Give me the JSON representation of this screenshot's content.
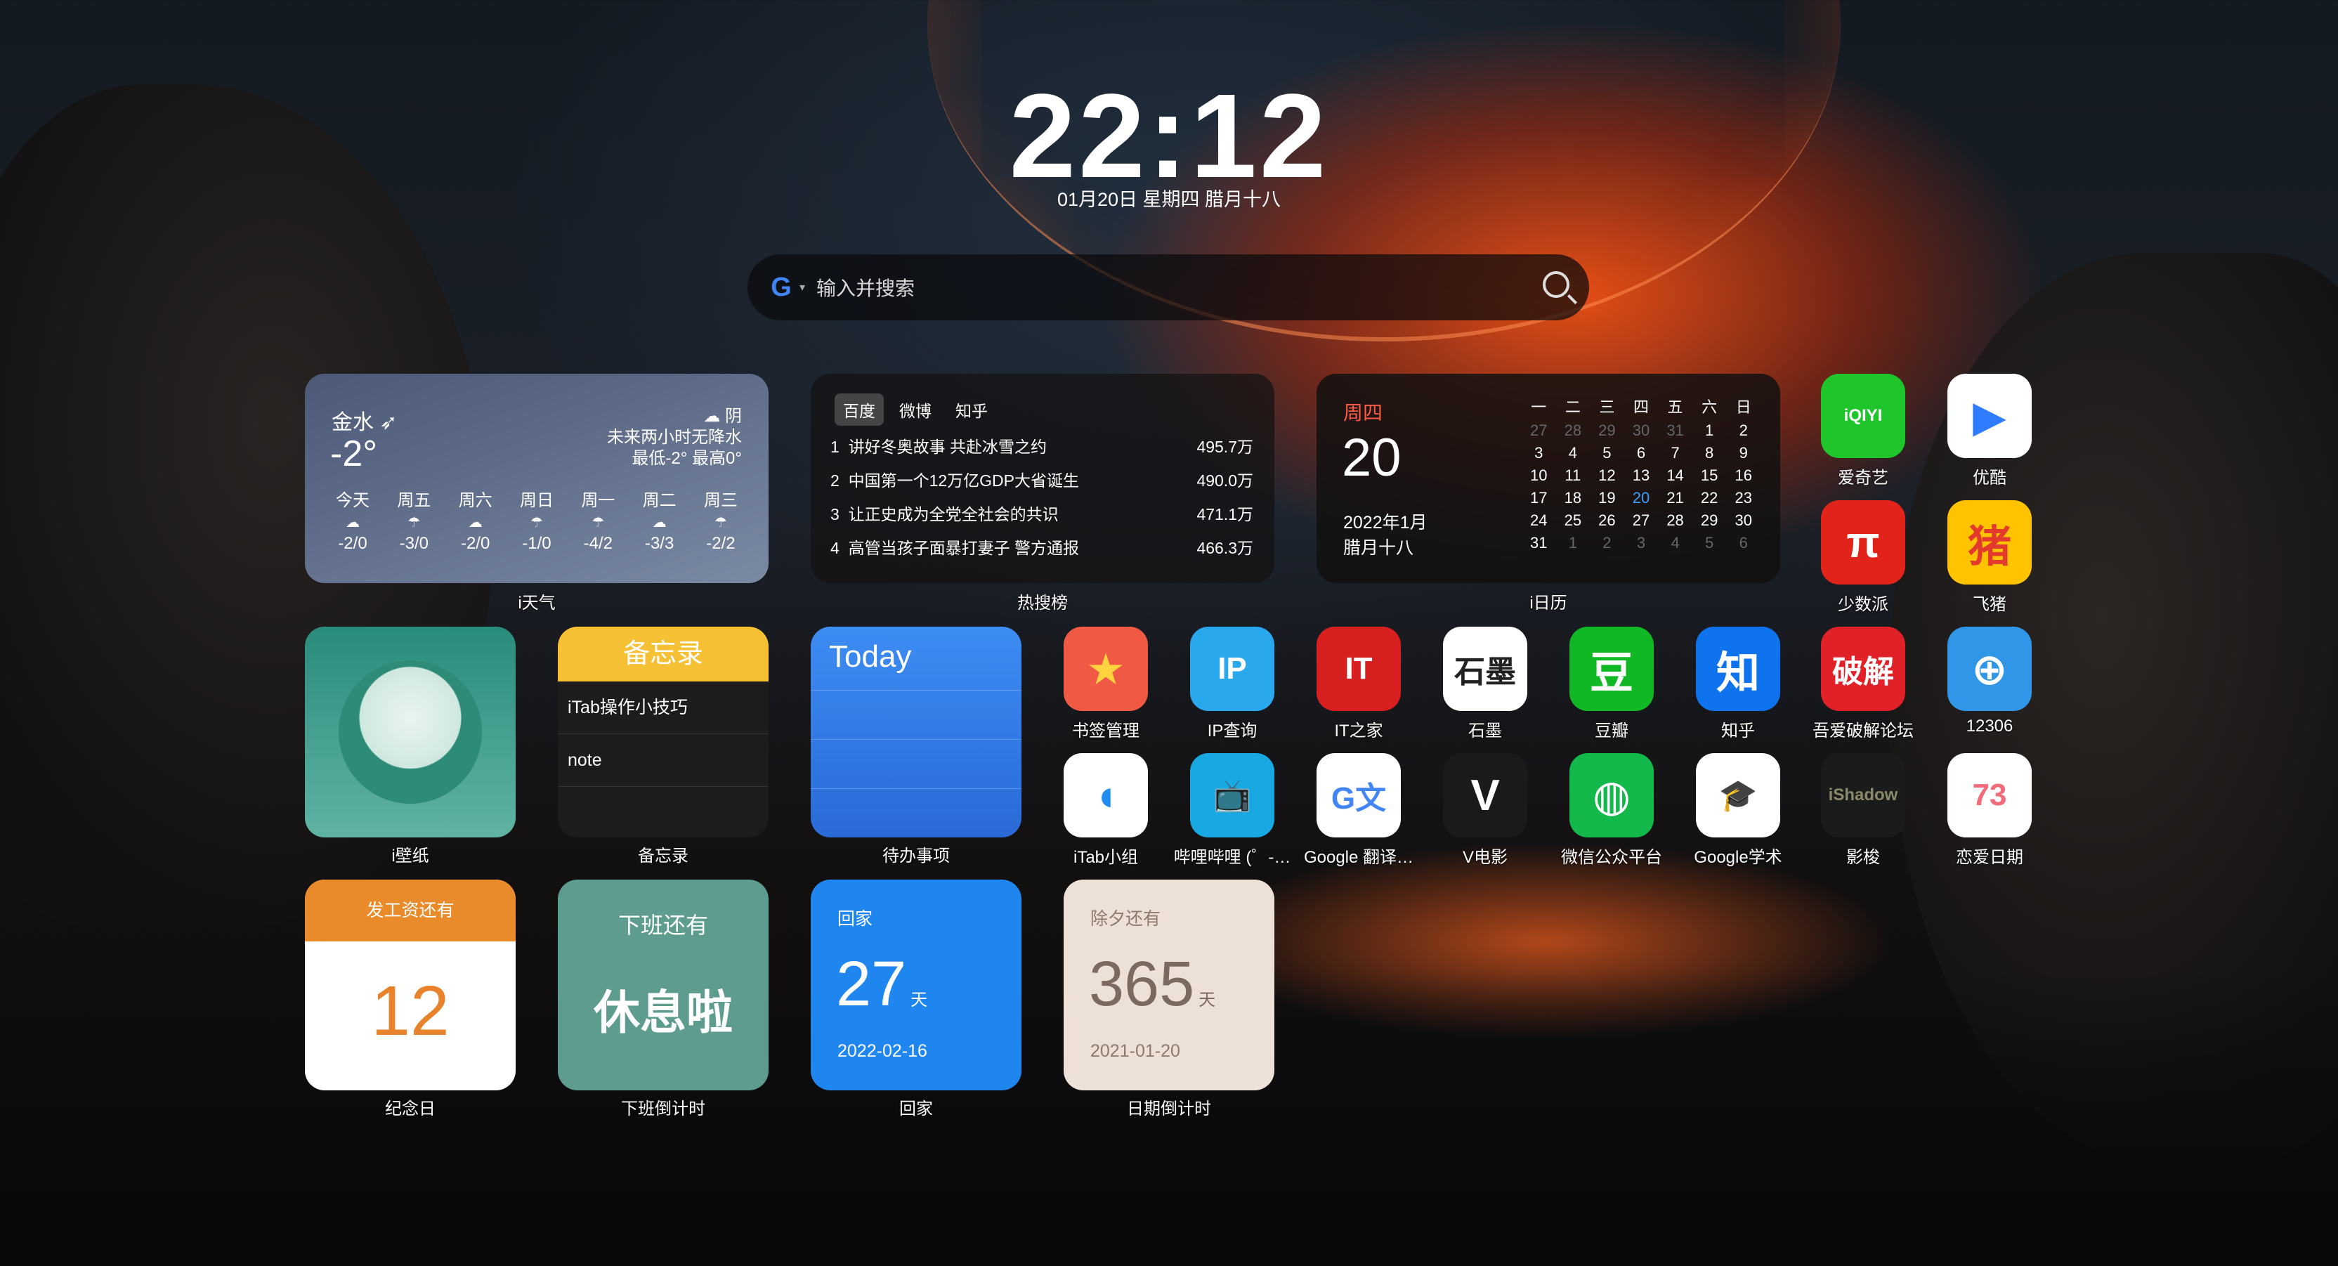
{
  "clock": {
    "time": "22:12",
    "date": "01月20日 星期四 腊月十八"
  },
  "search": {
    "engine_icon": "G",
    "placeholder": "输入并搜索"
  },
  "weather": {
    "city": "金水",
    "temp": "-2°",
    "condition": "阴",
    "forecast_note": "未来两小时无降水",
    "range": "最低-2° 最高0°",
    "widget_label": "i天气",
    "days": [
      {
        "name": "今天",
        "icon": "☁",
        "range": "-2/0"
      },
      {
        "name": "周五",
        "icon": "☂",
        "range": "-3/0"
      },
      {
        "name": "周六",
        "icon": "☁",
        "range": "-2/0"
      },
      {
        "name": "周日",
        "icon": "☂",
        "range": "-1/0"
      },
      {
        "name": "周一",
        "icon": "☂",
        "range": "-4/2"
      },
      {
        "name": "周二",
        "icon": "☁",
        "range": "-3/3"
      },
      {
        "name": "周三",
        "icon": "☂",
        "range": "-2/2"
      }
    ]
  },
  "hot": {
    "tabs": [
      "百度",
      "微博",
      "知乎"
    ],
    "widget_label": "热搜榜",
    "items": [
      {
        "rank": "1",
        "title": "讲好冬奥故事 共赴冰雪之约",
        "value": "495.7万"
      },
      {
        "rank": "2",
        "title": "中国第一个12万亿GDP大省诞生",
        "value": "490.0万"
      },
      {
        "rank": "3",
        "title": "让正史成为全党全社会的共识",
        "value": "471.1万"
      },
      {
        "rank": "4",
        "title": "高管当孩子面暴打妻子 警方通报",
        "value": "466.3万"
      }
    ]
  },
  "calendar": {
    "weekday": "周四",
    "day": "20",
    "year_month": "2022年1月",
    "lunar": "腊月十八",
    "widget_label": "i日历",
    "headers": [
      "一",
      "二",
      "三",
      "四",
      "五",
      "六",
      "日"
    ],
    "cells": [
      {
        "d": "27",
        "s": "dim"
      },
      {
        "d": "28",
        "s": "dim"
      },
      {
        "d": "29",
        "s": "dim"
      },
      {
        "d": "30",
        "s": "dim"
      },
      {
        "d": "31",
        "s": "dim"
      },
      {
        "d": "1",
        "s": ""
      },
      {
        "d": "2",
        "s": ""
      },
      {
        "d": "3",
        "s": ""
      },
      {
        "d": "4",
        "s": ""
      },
      {
        "d": "5",
        "s": ""
      },
      {
        "d": "6",
        "s": ""
      },
      {
        "d": "7",
        "s": ""
      },
      {
        "d": "8",
        "s": ""
      },
      {
        "d": "9",
        "s": ""
      },
      {
        "d": "10",
        "s": ""
      },
      {
        "d": "11",
        "s": ""
      },
      {
        "d": "12",
        "s": ""
      },
      {
        "d": "13",
        "s": ""
      },
      {
        "d": "14",
        "s": ""
      },
      {
        "d": "15",
        "s": ""
      },
      {
        "d": "16",
        "s": ""
      },
      {
        "d": "17",
        "s": ""
      },
      {
        "d": "18",
        "s": ""
      },
      {
        "d": "19",
        "s": ""
      },
      {
        "d": "20",
        "s": "today"
      },
      {
        "d": "21",
        "s": ""
      },
      {
        "d": "22",
        "s": ""
      },
      {
        "d": "23",
        "s": ""
      },
      {
        "d": "24",
        "s": ""
      },
      {
        "d": "25",
        "s": ""
      },
      {
        "d": "26",
        "s": ""
      },
      {
        "d": "27",
        "s": ""
      },
      {
        "d": "28",
        "s": ""
      },
      {
        "d": "29",
        "s": ""
      },
      {
        "d": "30",
        "s": ""
      },
      {
        "d": "31",
        "s": ""
      },
      {
        "d": "1",
        "s": "dim"
      },
      {
        "d": "2",
        "s": "dim"
      },
      {
        "d": "3",
        "s": "dim"
      },
      {
        "d": "4",
        "s": "dim"
      },
      {
        "d": "5",
        "s": "dim"
      },
      {
        "d": "6",
        "s": "dim"
      }
    ]
  },
  "widgets": {
    "wallpaper_label": "i壁纸",
    "memo": {
      "title": "备忘录",
      "rows": [
        "iTab操作小技巧",
        "note"
      ],
      "label": "备忘录"
    },
    "todo": {
      "title": "Today",
      "label": "待办事项"
    },
    "payday": {
      "title": "发工资还有",
      "num": "12",
      "label": "纪念日"
    },
    "offwork": {
      "title": "下班还有",
      "main": "休息啦",
      "label": "下班倒计时"
    },
    "home": {
      "title": "回家",
      "num": "27",
      "unit": "天",
      "date": "2022-02-16",
      "label": "回家"
    },
    "eve": {
      "title": "除夕还有",
      "num": "365",
      "unit": "天",
      "date": "2021-01-20",
      "label": "日期倒计时"
    }
  },
  "apps": [
    {
      "name": "爱奇艺",
      "glyph": "iQIYI",
      "bg": "#1fc62b",
      "fg": "#fff"
    },
    {
      "name": "优酷",
      "glyph": "▶",
      "bg": "#ffffff",
      "fg": "#2f7cff"
    },
    {
      "name": "少数派",
      "glyph": "π",
      "bg": "#e2231a",
      "fg": "#fff"
    },
    {
      "name": "飞猪",
      "glyph": "猪",
      "bg": "#ffc300",
      "fg": "#e43a2d"
    },
    {
      "name": "书签管理",
      "glyph": "★",
      "bg": "#f05a45",
      "fg": "#ffd23f"
    },
    {
      "name": "IP查询",
      "glyph": "IP",
      "bg": "#2aa8ee",
      "fg": "#fff"
    },
    {
      "name": "IT之家",
      "glyph": "IT",
      "bg": "#d7201f",
      "fg": "#fff"
    },
    {
      "name": "石墨",
      "glyph": "石墨",
      "bg": "#ffffff",
      "fg": "#222"
    },
    {
      "name": "豆瓣",
      "glyph": "豆",
      "bg": "#10b825",
      "fg": "#fff"
    },
    {
      "name": "知乎",
      "glyph": "知",
      "bg": "#0f73ee",
      "fg": "#fff"
    },
    {
      "name": "吾爱破解论坛",
      "glyph": "破解",
      "bg": "#e02228",
      "fg": "#fff"
    },
    {
      "name": "12306",
      "glyph": "⊕",
      "bg": "#2f96e8",
      "fg": "#fff"
    },
    {
      "name": "iTab小组",
      "glyph": "◖",
      "bg": "#ffffff",
      "fg": "#1f8ef0"
    },
    {
      "name": "哔哩哔哩 (゜-…",
      "glyph": "📺",
      "bg": "#18a9e3",
      "fg": "#fff"
    },
    {
      "name": "Google 翻译…",
      "glyph": "G文",
      "bg": "#ffffff",
      "fg": "#4285f4"
    },
    {
      "name": "V电影",
      "glyph": "V",
      "bg": "#1a1a1a",
      "fg": "#fff"
    },
    {
      "name": "微信公众平台",
      "glyph": "◍",
      "bg": "#12b84a",
      "fg": "#fff"
    },
    {
      "name": "Google学术",
      "glyph": "🎓",
      "bg": "#ffffff",
      "fg": "#4285f4"
    },
    {
      "name": "影梭",
      "glyph": "iShadow",
      "bg": "#1b1b1b",
      "fg": "#8a8a6a"
    },
    {
      "name": "恋爱日期",
      "glyph": "73",
      "bg": "#ffffff",
      "fg": "#f26b7a"
    }
  ]
}
